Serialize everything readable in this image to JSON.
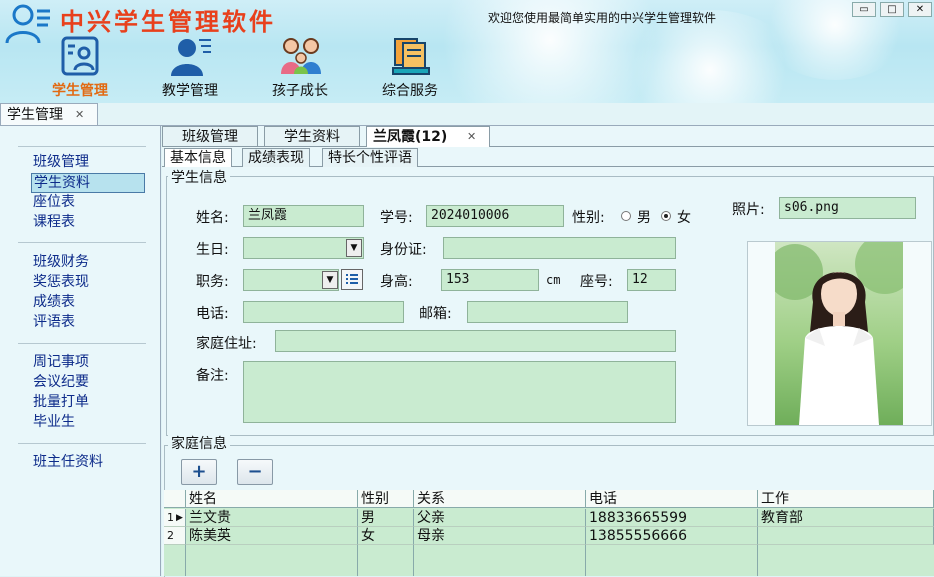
{
  "app": {
    "title": "中兴学生管理软件",
    "welcome": "欢迎您使用最简单实用的中兴学生管理软件",
    "window_buttons": [
      "▭",
      "□",
      "✕"
    ]
  },
  "nav": [
    {
      "label": "学生管理",
      "icon": "student-card-icon",
      "active": true
    },
    {
      "label": "教学管理",
      "icon": "teacher-icon",
      "active": false
    },
    {
      "label": "孩子成长",
      "icon": "family-icon",
      "active": false
    },
    {
      "label": "综合服务",
      "icon": "books-icon",
      "active": false
    }
  ],
  "top_tab": {
    "label": "学生管理",
    "close": "✕"
  },
  "sidebar": {
    "group1": [
      "班级管理",
      "学生资料",
      "座位表",
      "课程表"
    ],
    "group2": [
      "班级财务",
      "奖惩表现",
      "成绩表",
      "评语表"
    ],
    "group3": [
      "周记事项",
      "会议纪要",
      "批量打单",
      "毕业生"
    ],
    "group4": [
      "班主任资料"
    ],
    "selected": "学生资料"
  },
  "tabs": {
    "level1": [
      "班级管理",
      "学生资料",
      "兰凤霞(12)"
    ],
    "active1": 2,
    "close": "✕",
    "level2": [
      "基本信息",
      "成绩表现",
      "特长个性评语"
    ],
    "active2": 0
  },
  "student": {
    "group_title": "学生信息",
    "name_label": "姓名:",
    "name": "兰凤霞",
    "id_label": "学号:",
    "id": "2024010006",
    "gender_label": "性别:",
    "gender_options": [
      "男",
      "女"
    ],
    "gender": "女",
    "photo_label": "照片:",
    "photo": "s06.png",
    "birthday_label": "生日:",
    "birthday": "",
    "idcard_label": "身份证:",
    "idcard": "",
    "duty_label": "职务:",
    "duty": "",
    "height_label": "身高:",
    "height": "153",
    "height_unit": "cm",
    "seat_label": "座号:",
    "seat": "12",
    "phone_label": "电话:",
    "phone": "",
    "email_label": "邮箱:",
    "email": "",
    "address_label": "家庭住址:",
    "address": "",
    "remark_label": "备注:",
    "remark": ""
  },
  "family": {
    "group_title": "家庭信息",
    "add_label": "+",
    "remove_label": "−",
    "columns": [
      "姓名",
      "性别",
      "关系",
      "电话",
      "工作"
    ],
    "rows": [
      {
        "no": "1",
        "name": "兰文贵",
        "gender": "男",
        "relation": "父亲",
        "phone": "18833665599",
        "work": "教育部"
      },
      {
        "no": "2",
        "name": "陈美英",
        "gender": "女",
        "relation": "母亲",
        "phone": "13855556666",
        "work": ""
      }
    ],
    "current_marker": "▶"
  },
  "colors": {
    "title": "#e8401c",
    "active_nav": "#e26a12",
    "field": "#c9ebd0",
    "sidebar_link": "#0d2b8a"
  }
}
